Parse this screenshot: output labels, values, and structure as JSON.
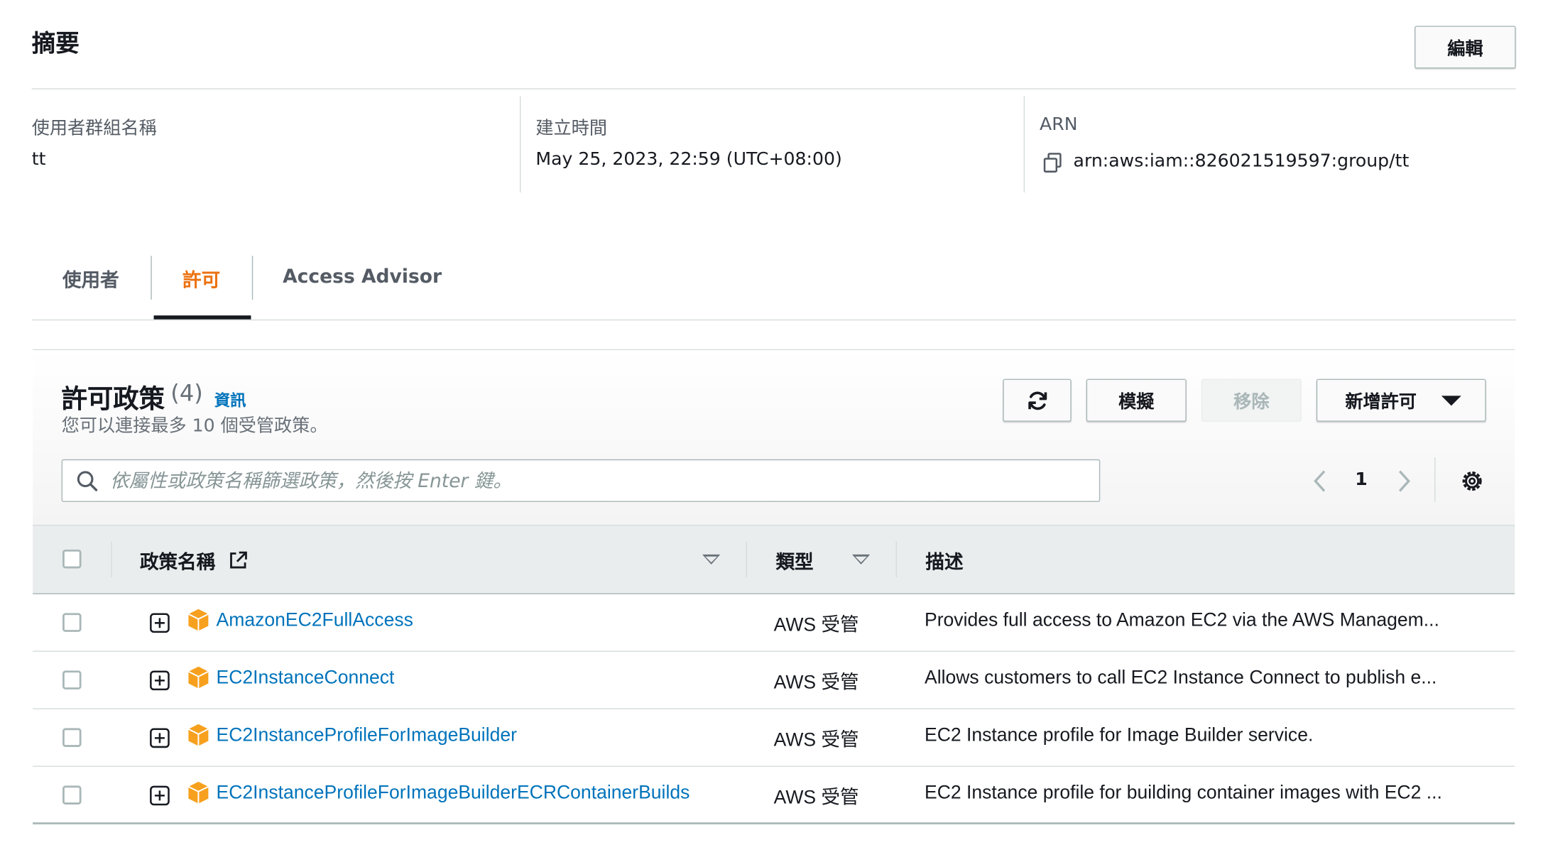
{
  "summary": {
    "title": "摘要",
    "edit_label": "編輯",
    "group_name_label": "使用者群組名稱",
    "group_name_value": "tt",
    "created_label": "建立時間",
    "created_value": "May 25, 2023, 22:59 (UTC+08:00)",
    "arn_label": "ARN",
    "arn_value": "arn:aws:iam::826021519597:group/tt"
  },
  "tabs": [
    {
      "label": "使用者",
      "active": false
    },
    {
      "label": "許可",
      "active": true
    },
    {
      "label": "Access Advisor",
      "active": false
    }
  ],
  "permissions": {
    "title": "許可政策",
    "count": "(4)",
    "info_link": "資訊",
    "description": "您可以連接最多 10 個受管政策。",
    "simulate_label": "模擬",
    "remove_label": "移除",
    "add_label": "新增許可",
    "search_placeholder": "依屬性或政策名稱篩選政策，然後按 Enter 鍵。",
    "page_number": "1",
    "columns": {
      "name": "政策名稱",
      "type": "類型",
      "description": "描述"
    },
    "rows": [
      {
        "name": "AmazonEC2FullAccess",
        "type": "AWS 受管",
        "description": "Provides full access to Amazon EC2 via the AWS Managem..."
      },
      {
        "name": "EC2InstanceConnect",
        "type": "AWS 受管",
        "description": "Allows customers to call EC2 Instance Connect to publish e..."
      },
      {
        "name": "EC2InstanceProfileForImageBuilder",
        "type": "AWS 受管",
        "description": "EC2 Instance profile for Image Builder service."
      },
      {
        "name": "EC2InstanceProfileForImageBuilderECRContainerBuilds",
        "type": "AWS 受管",
        "description": "EC2 Instance profile for building container images with EC2 ..."
      }
    ]
  },
  "colors": {
    "accent": "#ec7211",
    "link": "#0073bb",
    "policy_icon": "#f7a01e"
  }
}
